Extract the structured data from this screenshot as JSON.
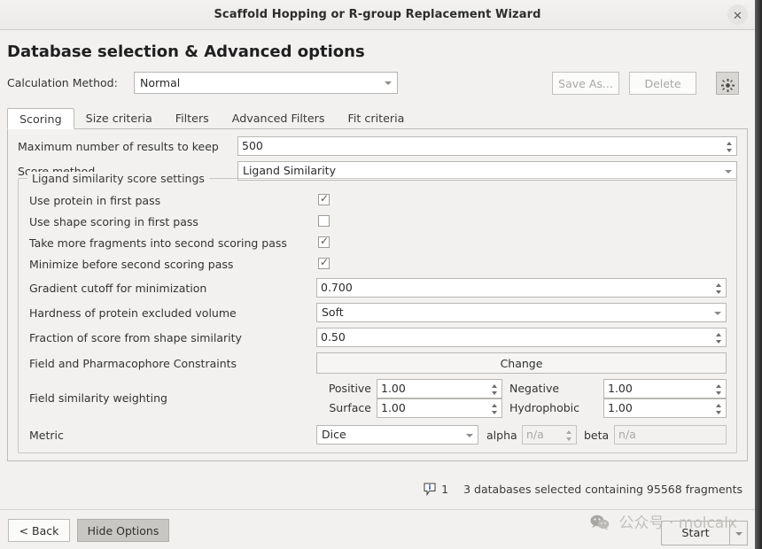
{
  "window": {
    "title": "Scaffold Hopping or R-group Replacement Wizard",
    "close_icon": "close-icon"
  },
  "heading": "Database selection & Advanced options",
  "toolbar": {
    "calc_method_label": "Calculation Method:",
    "calc_method_value": "Normal",
    "save_as_label": "Save As...",
    "delete_label": "Delete",
    "gear_icon": "gear-icon"
  },
  "tabs": [
    {
      "label": "Scoring",
      "active": true
    },
    {
      "label": "Size criteria",
      "active": false
    },
    {
      "label": "Filters",
      "active": false
    },
    {
      "label": "Advanced Filters",
      "active": false
    },
    {
      "label": "Fit criteria",
      "active": false
    }
  ],
  "scoring": {
    "max_results_label": "Maximum number of results to keep",
    "max_results_value": "500",
    "score_method_label": "Score method",
    "score_method_value": "Ligand Similarity",
    "group_title": "Ligand similarity score settings",
    "checkboxes": [
      {
        "label": "Use protein in first pass",
        "checked": true
      },
      {
        "label": "Use shape scoring in first pass",
        "checked": false
      },
      {
        "label": "Take more fragments into second scoring pass",
        "checked": true
      },
      {
        "label": "Minimize before second scoring pass",
        "checked": true
      }
    ],
    "gradient_cutoff_label": "Gradient cutoff for minimization",
    "gradient_cutoff_value": "0.700",
    "hardness_label": "Hardness of protein excluded volume",
    "hardness_value": "Soft",
    "fraction_label": "Fraction of score from shape similarity",
    "fraction_value": "0.50",
    "constraints_label": "Field and Pharmacophore Constraints",
    "constraints_button": "Change",
    "weighting_label": "Field similarity weighting",
    "weights": [
      {
        "label": "Positive",
        "value": "1.00"
      },
      {
        "label": "Negative",
        "value": "1.00"
      },
      {
        "label": "Surface",
        "value": "1.00"
      },
      {
        "label": "Hydrophobic",
        "value": "1.00"
      }
    ],
    "metric_label": "Metric",
    "metric_value": "Dice",
    "alpha_label": "alpha",
    "alpha_value": "n/a",
    "beta_label": "beta",
    "beta_value": "n/a"
  },
  "status": {
    "info_icon": "info-bubble-icon",
    "count": "1",
    "message": "3 databases selected containing 95568 fragments"
  },
  "footer": {
    "back_label": "< Back",
    "hide_options_label": "Hide Options",
    "start_label": "Start",
    "start_menu_icon": "chevron-down-icon"
  },
  "watermark": {
    "icon": "wechat-icon",
    "text": "公众号 · molcalx"
  }
}
